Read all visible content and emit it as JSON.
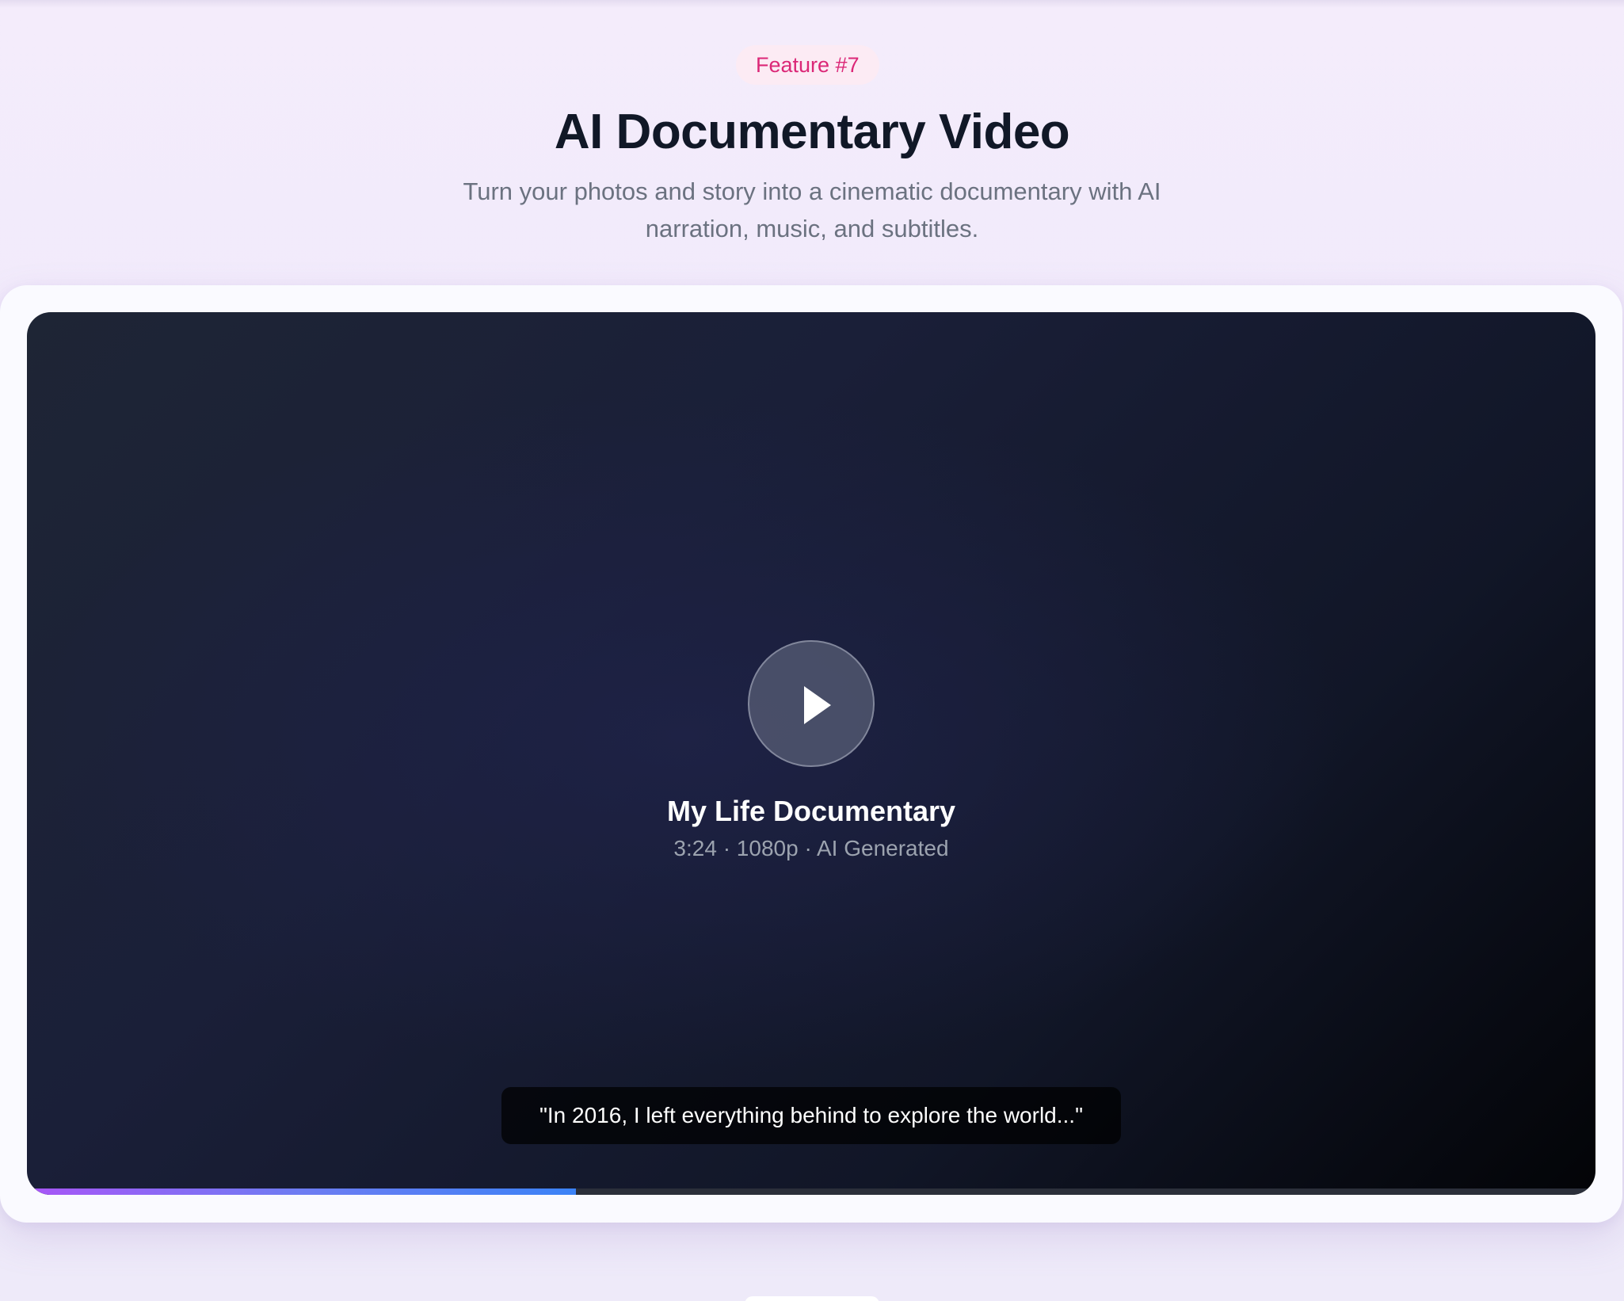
{
  "hero": {
    "badge": "Feature #7",
    "title": "AI Documentary Video",
    "subtitle": "Turn your photos and story into a cinematic documentary with AI narration, music, and subtitles."
  },
  "player": {
    "title": "My Life Documentary",
    "meta": "3:24 · 1080p · AI Generated",
    "caption": "\"In 2016, I left everything behind to explore the world...\"",
    "play_icon": "play-icon",
    "progress_fraction": 0.35,
    "accent_from": "#a855f7",
    "accent_to": "#3b82f6"
  },
  "colors": {
    "badge_text": "#db2777",
    "badge_bg": "#fcebf4",
    "title_text": "#111827",
    "subtitle_text": "#6b7280"
  }
}
